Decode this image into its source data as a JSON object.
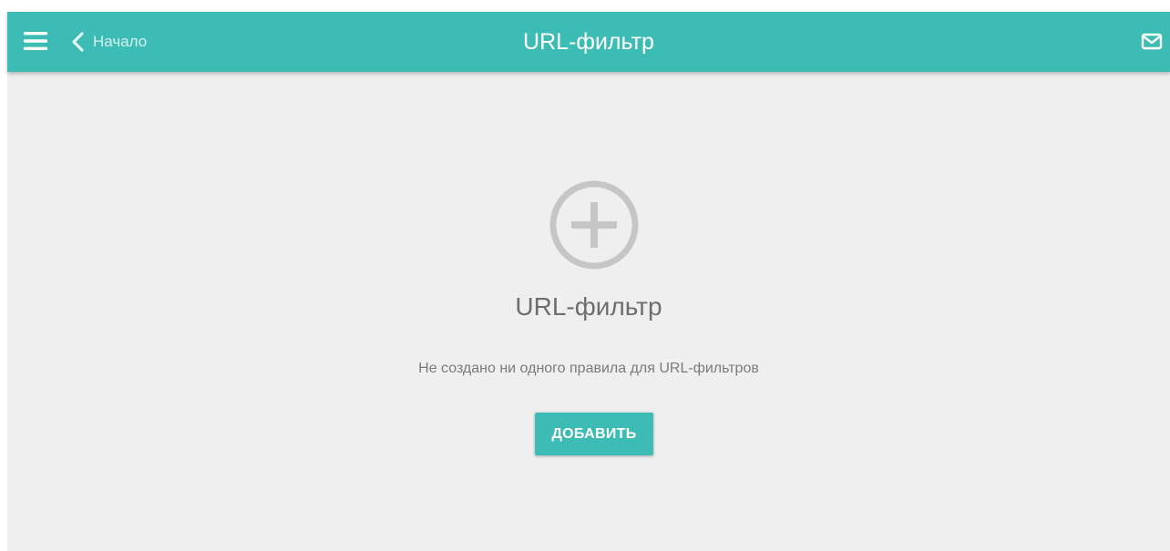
{
  "colors": {
    "accent": "#3cbcb4",
    "background": "#efefef",
    "icon_gray": "#c6c6c6"
  },
  "header": {
    "menu_icon": "hamburger-menu-icon",
    "back_icon": "chevron-left-icon",
    "back_label": "Начало",
    "title": "URL-фильтр",
    "mail_icon": "mail-icon"
  },
  "empty_state": {
    "icon": "add-circle-icon",
    "title": "URL-фильтр",
    "message": "Не создано ни одного правила для URL-фильтров",
    "add_button_label": "ДОБАВИТЬ"
  }
}
